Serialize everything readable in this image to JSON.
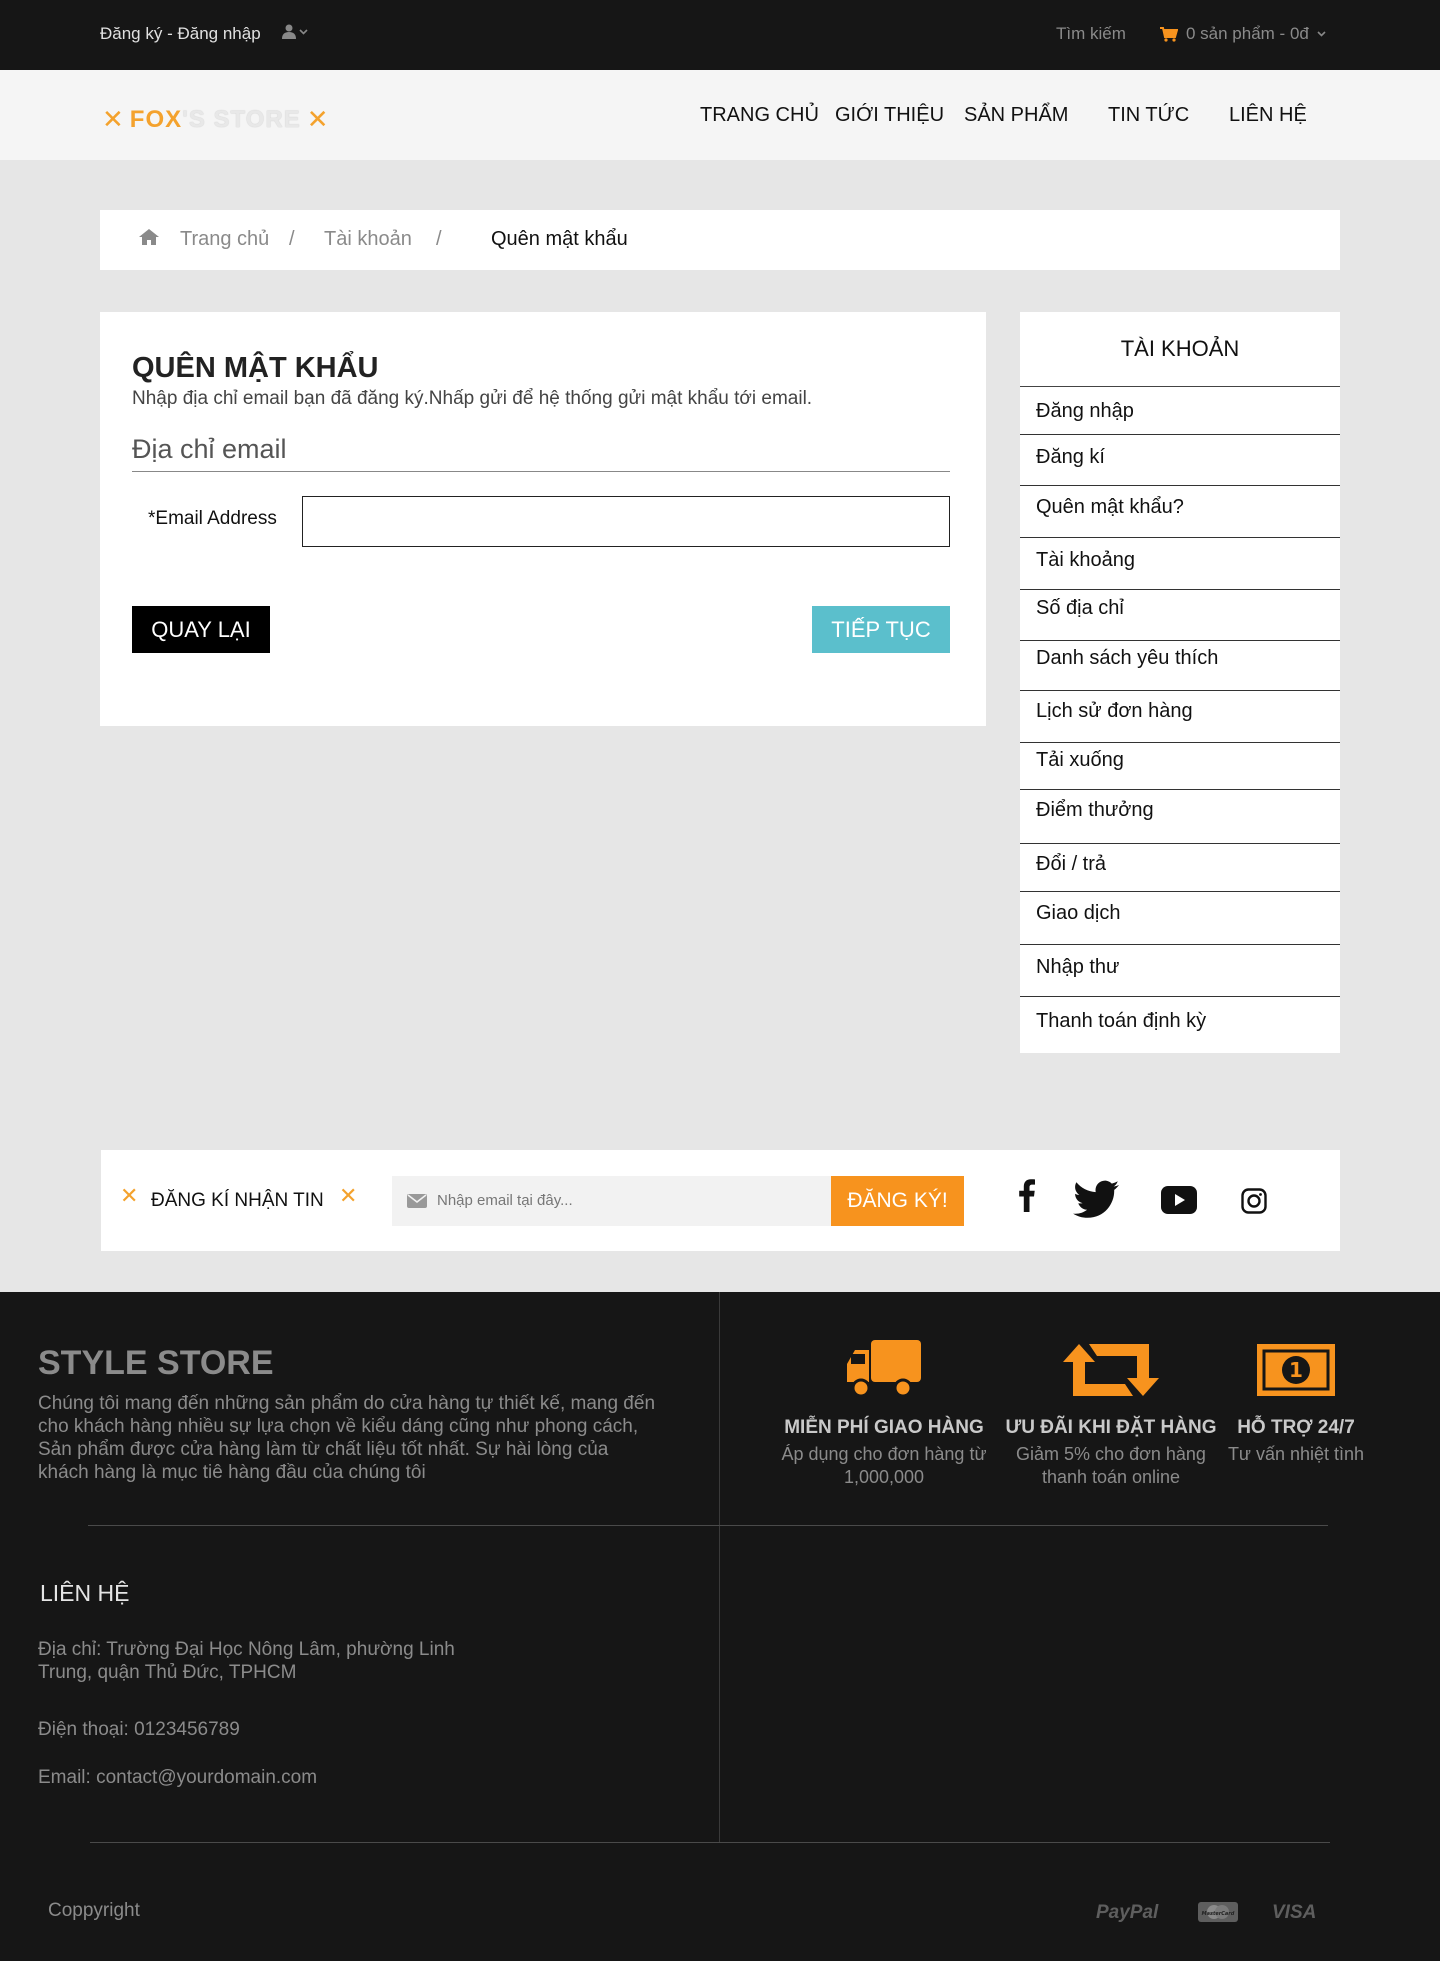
{
  "topbar": {
    "auth_text": "Đăng ký - Đăng nhập",
    "search_label": "Tìm kiếm",
    "cart_text": "0 sản phẩm - 0đ"
  },
  "header": {
    "logo_fox": "FOX",
    "logo_rest": "'S STORE",
    "nav": [
      "TRANG CHỦ",
      "GIỚI THIỆU",
      "SẢN PHẨM",
      "TIN TỨC",
      "LIÊN HỆ"
    ]
  },
  "breadcrumb": {
    "home": "Trang chủ",
    "account": "Tài khoản",
    "current": "Quên mật khẩu",
    "separator": "/"
  },
  "form": {
    "title": "QUÊN MẬT KHẨU",
    "description": "Nhập địa chỉ email bạn đã đăng ký.Nhấp gửi để hệ thống gửi mật khẩu tới email.",
    "legend": "Địa chỉ email",
    "email_label": "*Email Address",
    "email_value": "",
    "back_label": "QUAY LẠI",
    "continue_label": "TIẾP TỤC"
  },
  "sidebar": {
    "title": "TÀI KHOẢN",
    "items": [
      "Đăng nhập",
      "Đăng kí",
      "Quên mật khẩu?",
      "Tài khoảng",
      "Số địa chỉ",
      "Danh sách yêu thích",
      "Lịch sử đơn hàng",
      "Tải xuống",
      "Điểm thưởng",
      "Đổi / trả",
      "Giao dịch",
      "Nhập thư",
      "Thanh toán định kỳ"
    ]
  },
  "newsletter": {
    "label": "ĐĂNG KÍ NHẬN TIN",
    "placeholder": "Nhập email tại đây...",
    "button": "ĐĂNG KÝ!",
    "social_icons": [
      "facebook-icon",
      "twitter-icon",
      "youtube-icon",
      "instagram-icon"
    ]
  },
  "footer": {
    "store_title": "STYLE STORE",
    "store_description": "Chúng tôi mang đến những sản phẩm do cửa hàng tự thiết kế, mang đến cho khách hàng nhiều sự lựa chọn về kiểu dáng cũng như phong cách, Sản phẩm được cửa hàng làm từ chất liệu tốt nhất. Sự hài lòng của khách hàng là mục tiê hàng đầu của chúng tôi",
    "features": [
      {
        "title": "MIỄN PHÍ GIAO HÀNG",
        "desc": "Áp dụng cho đơn hàng từ 1,000,000",
        "icon": "truck-icon"
      },
      {
        "title": "ƯU ĐÃI KHI ĐẶT HÀNG",
        "desc": "Giảm 5% cho đơn hàng thanh toán online",
        "icon": "retweet-icon"
      },
      {
        "title": "HỖ TRỢ 24/7",
        "desc": "Tư vấn nhiệt tình",
        "icon": "money-icon"
      }
    ],
    "contact_title": "LIÊN HỆ",
    "address": "Địa chỉ: Trường Đại Học Nông Lâm, phường Linh Trung, quận Thủ Đức, TPHCM",
    "phone": "Điện thoại: 0123456789",
    "email": "Email: contact@yourdomain.com",
    "copyright": "Coppyright",
    "payments": [
      "PayPal",
      "MasterCard",
      "VISA"
    ]
  },
  "colors": {
    "accent": "#f7931e",
    "continue": "#5bbfcc",
    "dark": "#161616"
  }
}
